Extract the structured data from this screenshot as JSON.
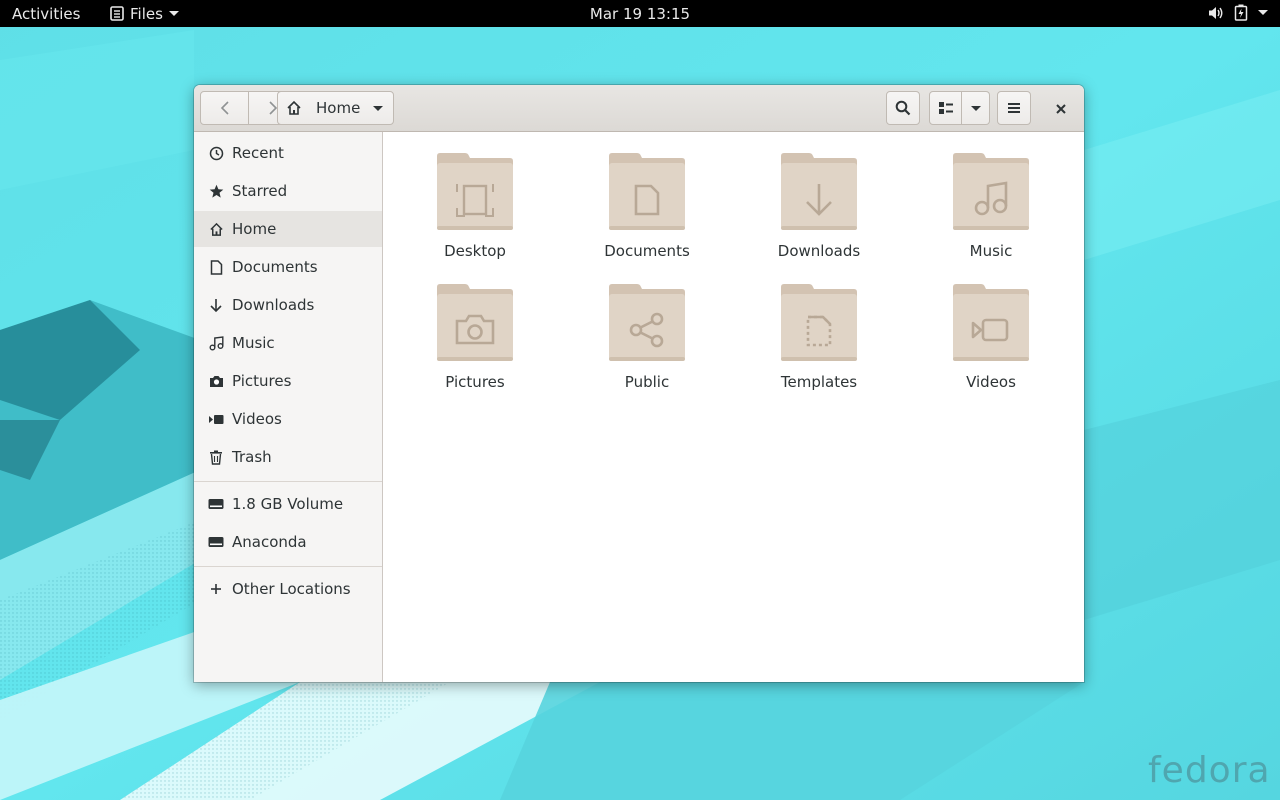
{
  "topbar": {
    "activities": "Activities",
    "app_name": "Files",
    "clock": "Mar 19  13:15"
  },
  "window": {
    "pathbar_label": "Home"
  },
  "sidebar": {
    "places": [
      {
        "label": "Recent",
        "icon": "clock-icon"
      },
      {
        "label": "Starred",
        "icon": "star-icon"
      },
      {
        "label": "Home",
        "icon": "home-icon",
        "active": true
      },
      {
        "label": "Documents",
        "icon": "document-icon"
      },
      {
        "label": "Downloads",
        "icon": "download-icon"
      },
      {
        "label": "Music",
        "icon": "music-icon"
      },
      {
        "label": "Pictures",
        "icon": "camera-icon"
      },
      {
        "label": "Videos",
        "icon": "video-icon"
      },
      {
        "label": "Trash",
        "icon": "trash-icon"
      }
    ],
    "devices": [
      {
        "label": "1.8 GB Volume",
        "icon": "drive-icon"
      },
      {
        "label": "Anaconda",
        "icon": "drive-icon"
      }
    ],
    "other": {
      "label": "Other Locations",
      "icon": "plus-icon"
    }
  },
  "folders": [
    {
      "label": "Desktop",
      "emblem": "desktop-emblem"
    },
    {
      "label": "Documents",
      "emblem": "document-emblem"
    },
    {
      "label": "Downloads",
      "emblem": "download-emblem"
    },
    {
      "label": "Music",
      "emblem": "music-emblem"
    },
    {
      "label": "Pictures",
      "emblem": "camera-emblem"
    },
    {
      "label": "Public",
      "emblem": "share-emblem"
    },
    {
      "label": "Templates",
      "emblem": "template-emblem"
    },
    {
      "label": "Videos",
      "emblem": "video-emblem"
    }
  ],
  "wallpaper": {
    "logo_text": "fedora",
    "colors": {
      "base": "#5fe3ea",
      "dark": "#2a9aa6",
      "light": "#bff6f8"
    }
  },
  "colors": {
    "folder_fill": "#e0d4c6",
    "folder_tab": "#d3c3b2",
    "folder_emblem": "#b8a896",
    "sidebar_bg": "#f6f5f4",
    "sidebar_active": "#e6e4e1",
    "headerbar": "#dcd9d5"
  }
}
